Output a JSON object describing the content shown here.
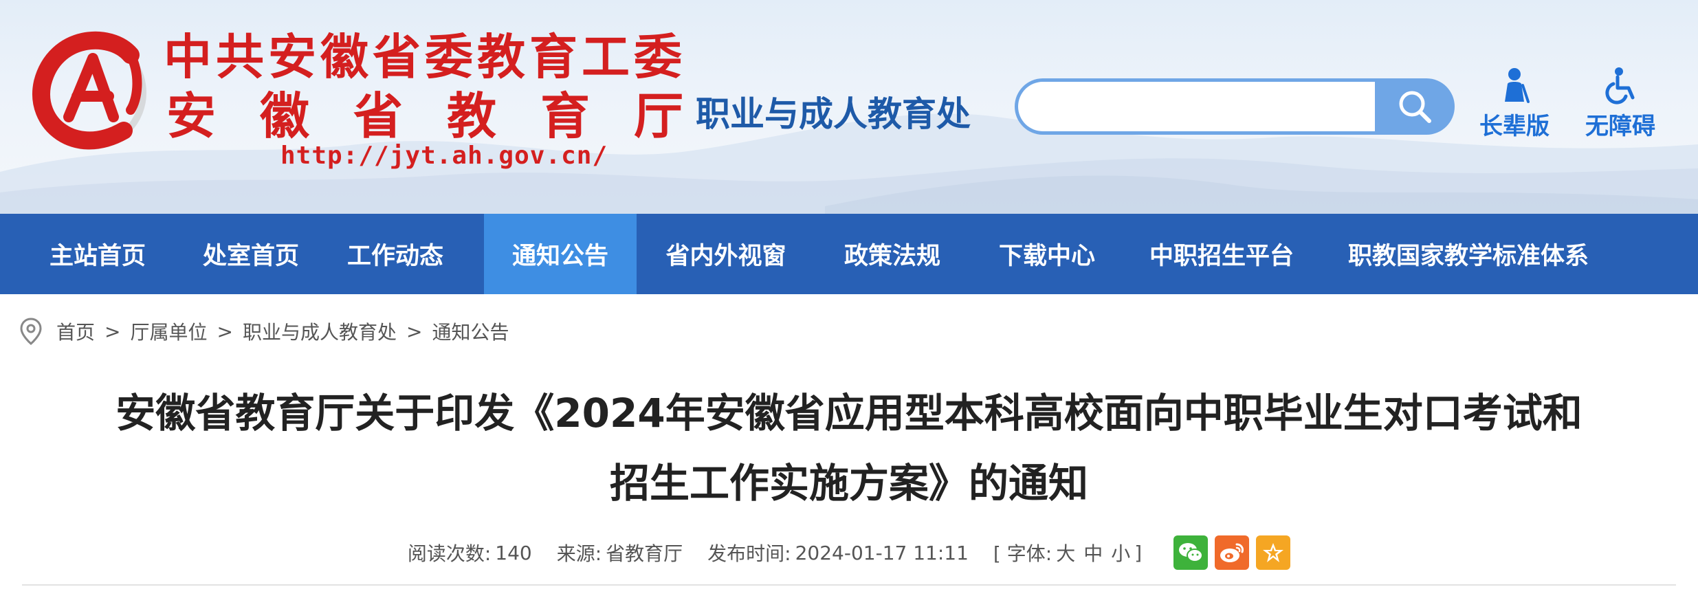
{
  "header": {
    "org_name": "中共安徽省委教育工委",
    "dept_name": "安徽省教育厅",
    "url": "http://jyt.ah.gov.cn/",
    "sub_title": "职业与成人教育处",
    "search": {
      "value": "",
      "placeholder": ""
    },
    "tools": {
      "elder": "长辈版",
      "access": "无障碍"
    }
  },
  "nav": {
    "items": [
      {
        "label": "主站首页",
        "active": false
      },
      {
        "label": "处室首页",
        "active": false
      },
      {
        "label": "工作动态",
        "active": false
      },
      {
        "label": "通知公告",
        "active": true
      },
      {
        "label": "省内外视窗",
        "active": false
      },
      {
        "label": "政策法规",
        "active": false
      },
      {
        "label": "下载中心",
        "active": false
      },
      {
        "label": "中职招生平台",
        "active": false
      },
      {
        "label": "职教国家教学标准体系",
        "active": false
      }
    ]
  },
  "breadcrumb": {
    "items": [
      "首页",
      "厅属单位",
      "职业与成人教育处",
      "通知公告"
    ],
    "separator": ">"
  },
  "article": {
    "title_line1": "安徽省教育厅关于印发《2024年安徽省应用型本科高校面向中职毕业生对口考试和",
    "title_line2": "招生工作实施方案》的通知",
    "meta": {
      "views_label": "阅读次数:",
      "views_value": "140",
      "source_label": "来源:",
      "source_value": "省教育厅",
      "date_label": "发布时间:",
      "date_value": "2024-01-17 11:11",
      "font_open": "[ 字体:",
      "font_large": "大",
      "font_medium": "中",
      "font_small": "小",
      "font_close": "]"
    }
  },
  "colors": {
    "brand_red": "#d41f1f",
    "nav_blue": "#2860b5",
    "nav_active": "#3e8ee3",
    "accent_blue": "#1e6fd6"
  },
  "icons": {
    "logo": "emblem-logo",
    "search": "search-icon",
    "elder": "elder-person-icon",
    "access": "wheelchair-icon",
    "location": "location-pin-icon",
    "wechat": "wechat-icon",
    "weibo": "weibo-icon",
    "favorite": "star-icon"
  }
}
